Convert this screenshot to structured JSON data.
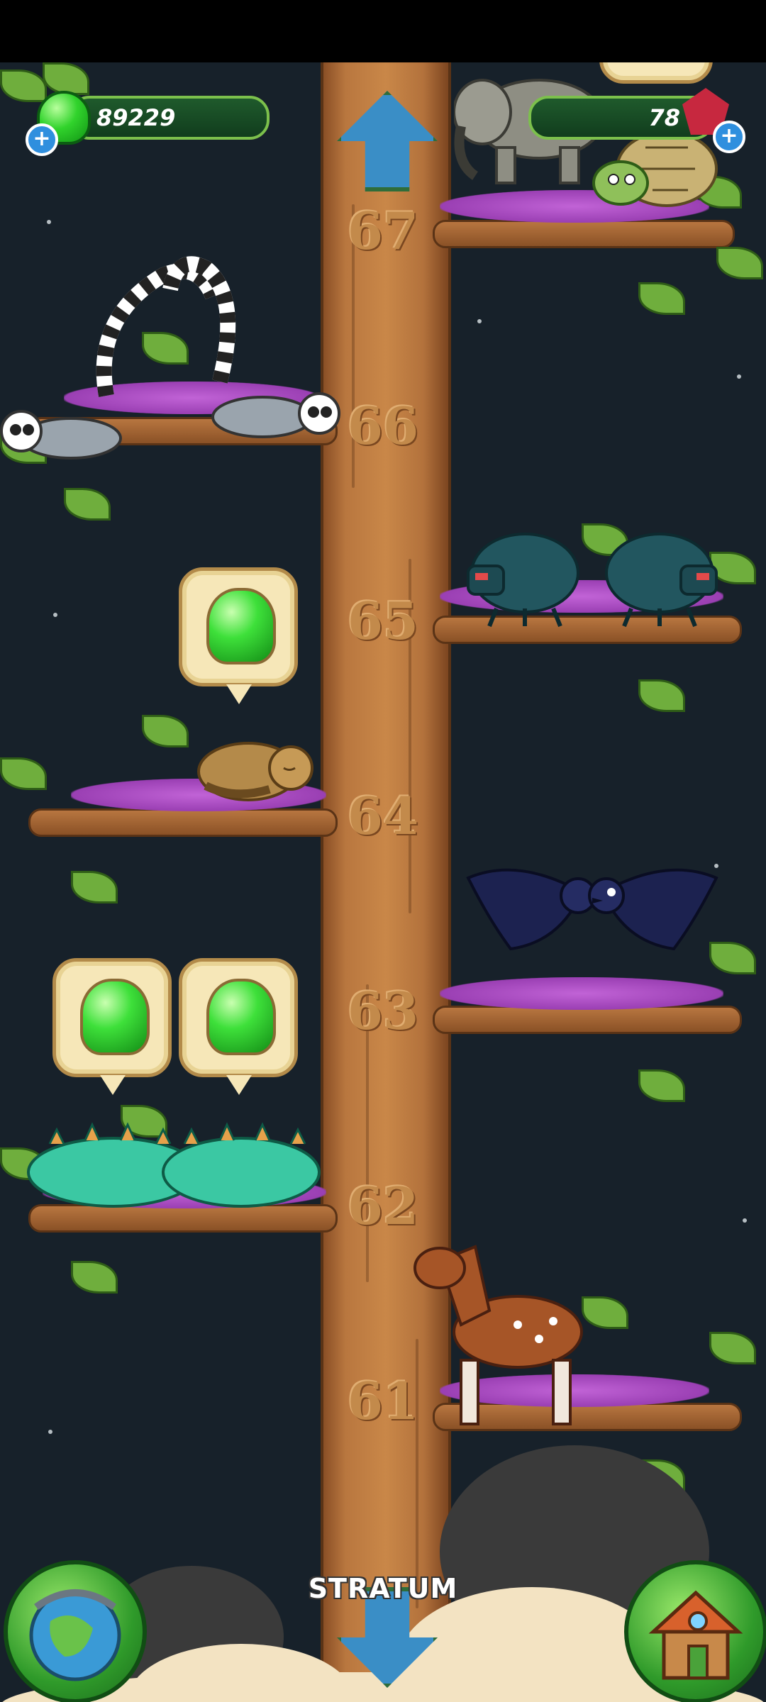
{
  "hud": {
    "gem_count": "89229",
    "crystal_count": "78"
  },
  "levels": [
    "67",
    "66",
    "65",
    "64",
    "63",
    "62",
    "61"
  ],
  "stratum_label": "STRATUM",
  "icons": {
    "gem": "green-gem-icon",
    "crystal": "red-crystal-icon",
    "plus": "plus-icon",
    "up": "arrow-up-icon",
    "down": "arrow-down-icon",
    "globe": "globe-icon",
    "house": "house-icon"
  },
  "plus_symbol": "+",
  "colors": {
    "gem_green": "#31d32c",
    "hud_border": "#7cc04c",
    "trunk": "#c98748",
    "moss": "#b24fcc"
  },
  "creatures": [
    {
      "level": "67",
      "name": "elephant"
    },
    {
      "level": "67",
      "name": "tortoise"
    },
    {
      "level": "66",
      "name": "lemur"
    },
    {
      "level": "66",
      "name": "lemur"
    },
    {
      "level": "65",
      "name": "beetle"
    },
    {
      "level": "65",
      "name": "beetle"
    },
    {
      "level": "64",
      "name": "sleeping cat"
    },
    {
      "level": "63",
      "name": "crow"
    },
    {
      "level": "63",
      "name": "crow"
    },
    {
      "level": "62",
      "name": "lizard"
    },
    {
      "level": "62",
      "name": "lizard"
    },
    {
      "level": "61",
      "name": "horse"
    }
  ]
}
